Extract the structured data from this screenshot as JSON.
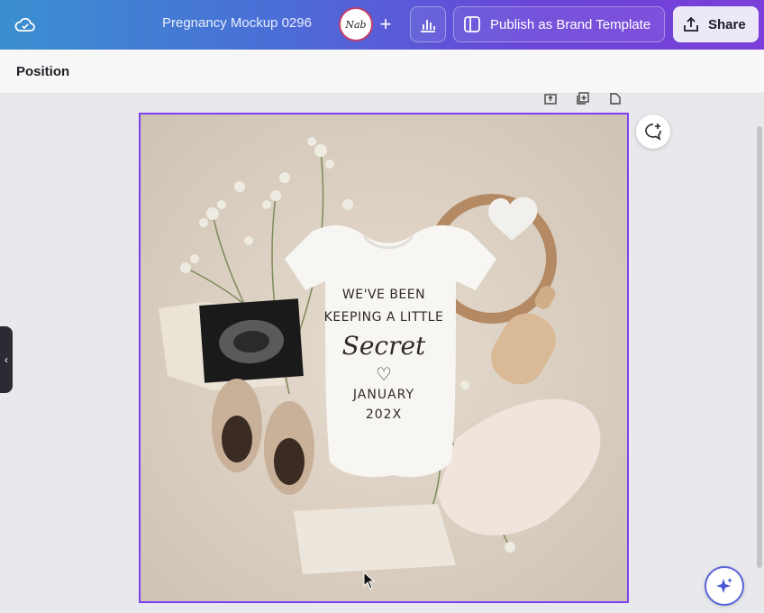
{
  "header": {
    "doc_title": "Pregnancy Mockup 0296",
    "avatar_initials": "Nab",
    "plus_label": "+",
    "publish_label": "Publish as Brand Template",
    "share_label": "Share"
  },
  "toolbar": {
    "position_label": "Position"
  },
  "design": {
    "line1": "WE'VE BEEN",
    "line2": "KEEPING A LITTLE",
    "script": "Secret",
    "heart": "♡",
    "date_month": "JANUARY",
    "date_year": "202X"
  },
  "sidebar_toggle": "‹",
  "colors": {
    "accent": "#7d3ff0",
    "topbar_start": "#3a8fd0",
    "topbar_end": "#7a3fd8",
    "share_bg": "#ece8f7"
  },
  "icons": [
    "cloud-sync-icon",
    "insights-icon",
    "brand-template-icon",
    "share-upload-icon",
    "add-comment-icon",
    "magic-sparkle-icon"
  ]
}
